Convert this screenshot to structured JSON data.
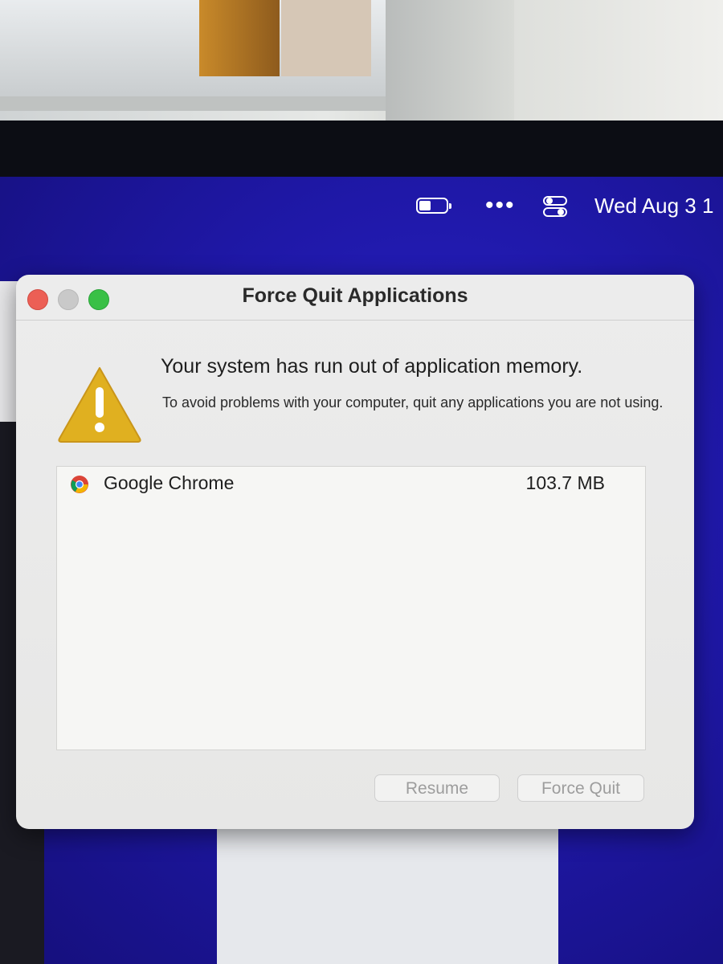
{
  "menubar": {
    "clock": "Wed Aug 3  1",
    "dots": "•••"
  },
  "dialog": {
    "title": "Force Quit Applications",
    "headline": "Your system has run out of application memory.",
    "message": "To avoid problems with your computer, quit any applications you are not using.",
    "apps": [
      {
        "name": "Google Chrome",
        "memory": "103.7 MB",
        "icon": "chrome-icon"
      }
    ],
    "buttons": {
      "resume": "Resume",
      "force_quit": "Force Quit"
    }
  },
  "colors": {
    "wallpaper": "#1f18a8",
    "close": "#ec5f55",
    "zoom": "#39c046",
    "warning": "#e0b020"
  }
}
